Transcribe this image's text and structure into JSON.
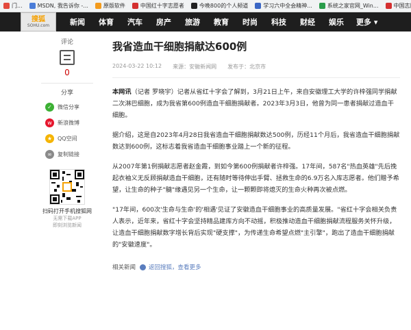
{
  "bookmarks": [
    {
      "label": "门...",
      "color": "#e34a3d"
    },
    {
      "label": "MSDN, 我告诉你 -...",
      "color": "#4a7dd8"
    },
    {
      "label": "原版软件",
      "color": "#f39b1d"
    },
    {
      "label": "中国红十字志愿者",
      "color": "#d43030"
    },
    {
      "label": "今晚800的个人频道",
      "color": "#222222"
    },
    {
      "label": "学习六中全会精神...",
      "color": "#3a66c4"
    },
    {
      "label": "系统之家官网_Win...",
      "color": "#2a9d4b"
    },
    {
      "label": "中国志愿",
      "color": "#d43030"
    }
  ],
  "bookmarks_more": "»",
  "logo": {
    "line1": "搜狐",
    "line2": "SOHU.com"
  },
  "nav": {
    "items": [
      "新闻",
      "体育",
      "汽车",
      "房产",
      "旅游",
      "教育",
      "时尚",
      "科技",
      "财经",
      "娱乐"
    ],
    "more": "更多 ▾"
  },
  "sidebar": {
    "comment_label": "评论",
    "comment_count": "0",
    "share_label": "分享",
    "share_items": [
      {
        "label": "微信分享",
        "icon": "wechat-icon",
        "color": "#3cb034",
        "glyph": "✓"
      },
      {
        "label": "新浪微博",
        "icon": "weibo-icon",
        "color": "#e6162d",
        "glyph": "w"
      },
      {
        "label": "QQ空间",
        "icon": "qzone-icon",
        "color": "#f5b400",
        "glyph": "★"
      },
      {
        "label": "复制链接",
        "icon": "link-icon",
        "color": "#8a8a8a",
        "glyph": "∞"
      }
    ],
    "qr_caption": "扫码打开手机搜狐网",
    "qr_sub1": "无需下载APP",
    "qr_sub2": "即刻浏览新闻"
  },
  "article": {
    "title": "我省造血干细胞捐献达600例",
    "time": "2024-03-22 10:12",
    "source": "来源：安徽新闻网",
    "published": "发布于：北京市",
    "lead_bold": "本网讯",
    "p1": "（记者 罗晓宇）记者从省红十字会了解到，3月21日上午，来自安徽理工大学的许梓强同学捐献二次淋巴细胞，成为我省第600例造血干细胞捐献者。2023年3月3日，他曾为同一患者捐献过造血干细胞。",
    "p2": "据介绍，这是自2023年4月28日我省造血干细胞捐献数达500例，历经11个月后，我省造血干细胞捐献数达到600例，这标志着我省造血干细胞事业踏上一个新的征程。",
    "p3": "从2007年第1例捐献志愿者赵金霞，到如今第600例捐献者许梓强。17年间，587名\"热血英雄\"先后挽起衣袖义无反顾捐献造血干细胞，还有随时等待伸出手臂、拯救生命的6.9万名入库志愿者。他们赠予希望，让生命的种子\"髓\"缘遇见另一个生命，让一颗颗即将熄灭的生命火种再次被点燃。",
    "p4": "\"17年间，600次'生命与生命'的'相遇'见证了安徽造血干细胞事业的高质量发展。\"省红十字会相关负责人表示，近年来，省红十字会坚持精品建库方向不动摇，积极推动造血干细胞捐献流程服务关怀升级，让造血干细胞捐献数字增长背后实现\"硬支撑\"，为传递生命希望点燃\"主引擎\"，跑出了造血干细胞捐献的\"安徽速度\"。",
    "related_label": "相关新闻",
    "back_link": "返回搜狐，查看更多"
  }
}
